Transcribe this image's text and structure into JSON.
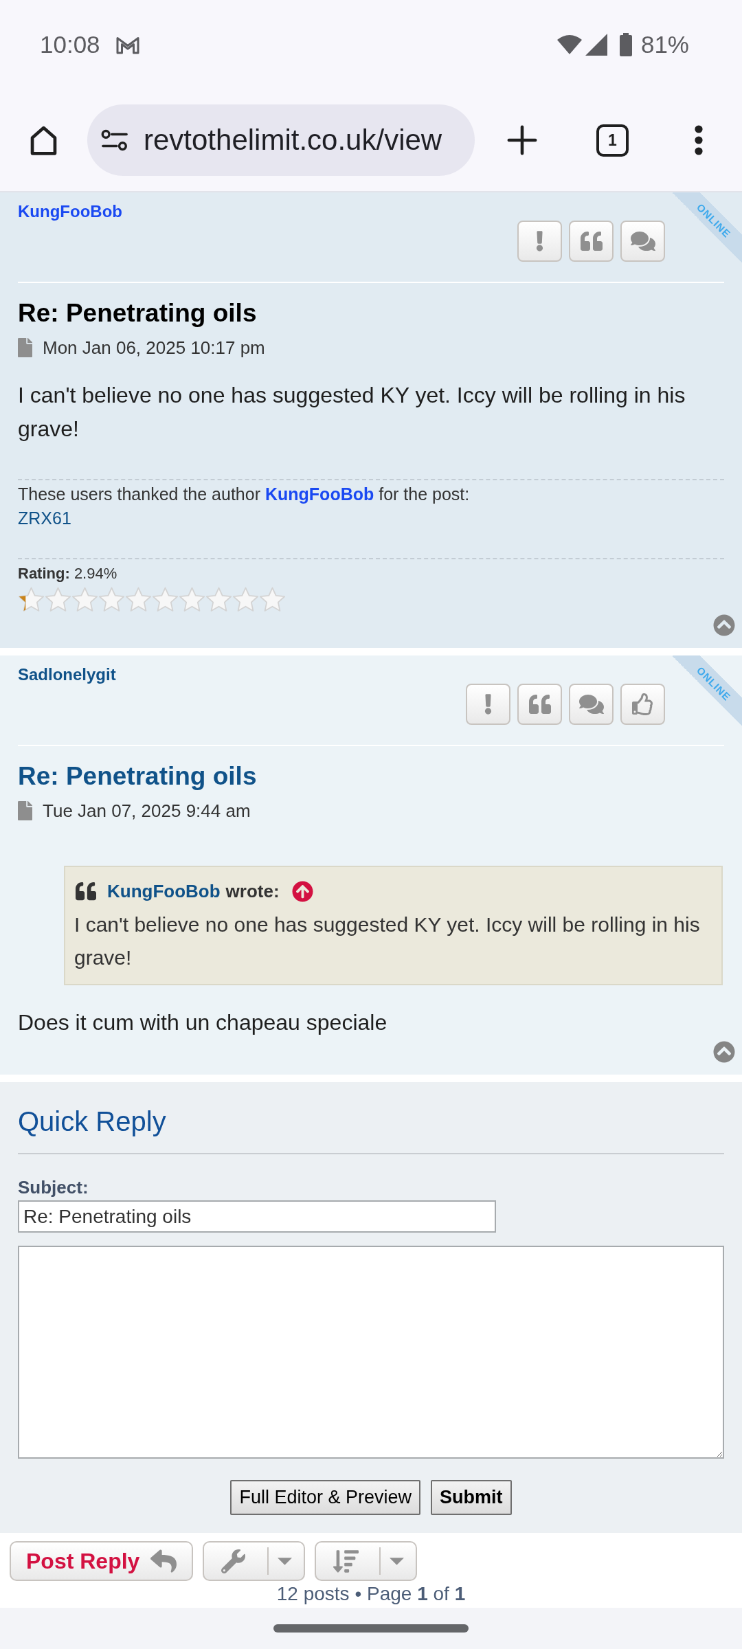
{
  "status_bar": {
    "time": "10:08",
    "battery": "81%"
  },
  "browser": {
    "url": "revtothelimit.co.uk/view",
    "tab_count": "1"
  },
  "posts": [
    {
      "author": {
        "name": "KungFooBob",
        "color": "#1a49f2"
      },
      "status_ribbon": "ONLINE",
      "actions": [
        {
          "kind": "report"
        },
        {
          "kind": "quote"
        },
        {
          "kind": "pm"
        }
      ],
      "title": {
        "text": "Re: Penetrating oils",
        "link": false
      },
      "date": "Mon Jan 06, 2025 10:17 pm",
      "body": "I can't believe no one has suggested KY yet. Iccy will be rolling in his grave!",
      "thanks": {
        "before": "These users thanked the author",
        "author": "KungFooBob",
        "after": "for the post:",
        "users": [
          "ZRX61"
        ]
      },
      "rating": {
        "text": "**Rating:** 2.94%",
        "stars": 0.29
      }
    },
    {
      "author": {
        "name": "Sadlonelygit",
        "color": "#105289"
      },
      "status_ribbon": "ONLINE",
      "actions": [
        {
          "kind": "report"
        },
        {
          "kind": "quote"
        },
        {
          "kind": "pm"
        },
        {
          "kind": "thanks"
        }
      ],
      "title": {
        "text": "Re: Penetrating oils",
        "link": true
      },
      "date": "Tue Jan 07, 2025 9:44 am",
      "quote": {
        "author": "KungFooBob",
        "label": "wrote:",
        "text": "I can't believe no one has suggested KY yet. Iccy will be rolling in his grave!"
      },
      "body": "Does it cum with un chapeau speciale"
    }
  ],
  "quick_reply": {
    "title": "Quick Reply",
    "subject_label": "Subject:",
    "subject_value": "Re: Penetrating oils",
    "buttons": [
      {
        "kind": "editor",
        "label": "Full Editor & Preview"
      },
      {
        "kind": "submit",
        "label": "Submit"
      }
    ]
  },
  "action_bar": {
    "buttons": [
      {
        "kind": "reply",
        "label": "Post Reply"
      },
      {
        "kind": "tools"
      },
      {
        "kind": "sort"
      }
    ],
    "pagination": "12 posts • Page **1** of **1**"
  }
}
